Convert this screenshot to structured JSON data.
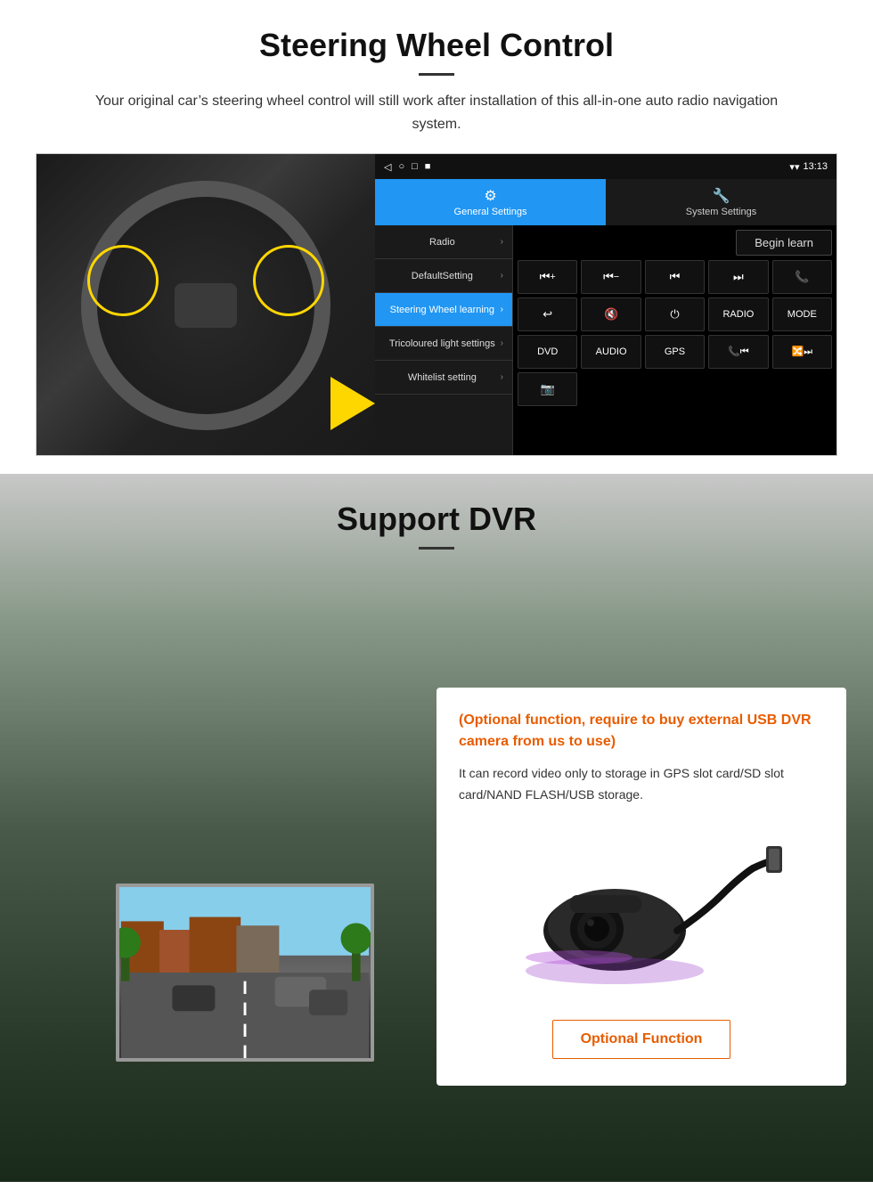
{
  "section1": {
    "title": "Steering Wheel Control",
    "subtitle": "Your original car’s steering wheel control will still work after installation of this all-in-one auto radio navigation system.",
    "statusbar": {
      "icons_left": [
        "◁",
        "○",
        "□",
        "■"
      ],
      "time": "13:13",
      "signal": "▾"
    },
    "tabs": [
      {
        "label": "General Settings",
        "icon": "⚙",
        "active": true
      },
      {
        "label": "System Settings",
        "icon": "🔧",
        "active": false
      }
    ],
    "menu_items": [
      {
        "label": "Radio",
        "active": false
      },
      {
        "label": "DefaultSetting",
        "active": false
      },
      {
        "label": "Steering Wheel learning",
        "active": true
      },
      {
        "label": "Tricoloured light settings",
        "active": false
      },
      {
        "label": "Whitelist setting",
        "active": false
      }
    ],
    "begin_learn_label": "Begin learn",
    "control_buttons": [
      "⏮+",
      "⏮−",
      "⏮⏮",
      "⏭⏭",
      "📞",
      "↩",
      "🔇",
      "⏻",
      "RADIO",
      "MODE",
      "DVD",
      "AUDIO",
      "GPS",
      "📞⏮",
      "🔀⏭"
    ],
    "bottom_btn": "📷"
  },
  "section2": {
    "title": "Support DVR",
    "optional_text": "(Optional function, require to buy external USB DVR camera from us to use)",
    "description": "It can record video only to storage in GPS slot card/SD slot card/NAND FLASH/USB storage.",
    "optional_function_label": "Optional Function",
    "accent_color": "#E85C00"
  }
}
